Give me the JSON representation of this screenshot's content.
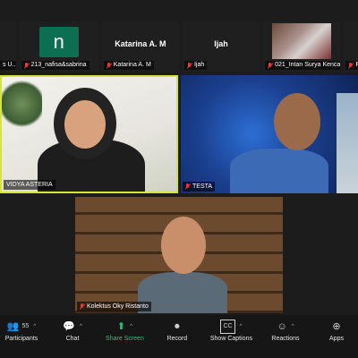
{
  "strip": [
    {
      "name": "s U...",
      "avatar_text": ""
    },
    {
      "name": "213_nafisa&sabrina",
      "avatar_text": "n"
    },
    {
      "name": "Katarina A. M",
      "center_name": "Katarina A. M"
    },
    {
      "name": "Ijah",
      "center_name": "Ijah"
    },
    {
      "name": "021_Intan Surya Kenca...",
      "photo": true
    },
    {
      "name": "PE"
    }
  ],
  "videos": {
    "left": {
      "name": "VIDYA ASTERIA"
    },
    "right": {
      "name": "TESTA"
    },
    "bottom": {
      "name": "Kolektus Oky Ristanto"
    }
  },
  "toolbar": {
    "participants": {
      "label": "Participants",
      "count": "55"
    },
    "chat": {
      "label": "Chat"
    },
    "share": {
      "label": "Share Screen"
    },
    "record": {
      "label": "Record"
    },
    "captions": {
      "label": "Show Captions",
      "badge": "CC"
    },
    "reactions": {
      "label": "Reactions"
    },
    "apps": {
      "label": "Apps"
    }
  },
  "colors": {
    "speaker_border": "#d7e43a",
    "share_green": "#2ec27e",
    "muted_red": "#e23b3b",
    "avatar_green": "#0d6f52"
  }
}
